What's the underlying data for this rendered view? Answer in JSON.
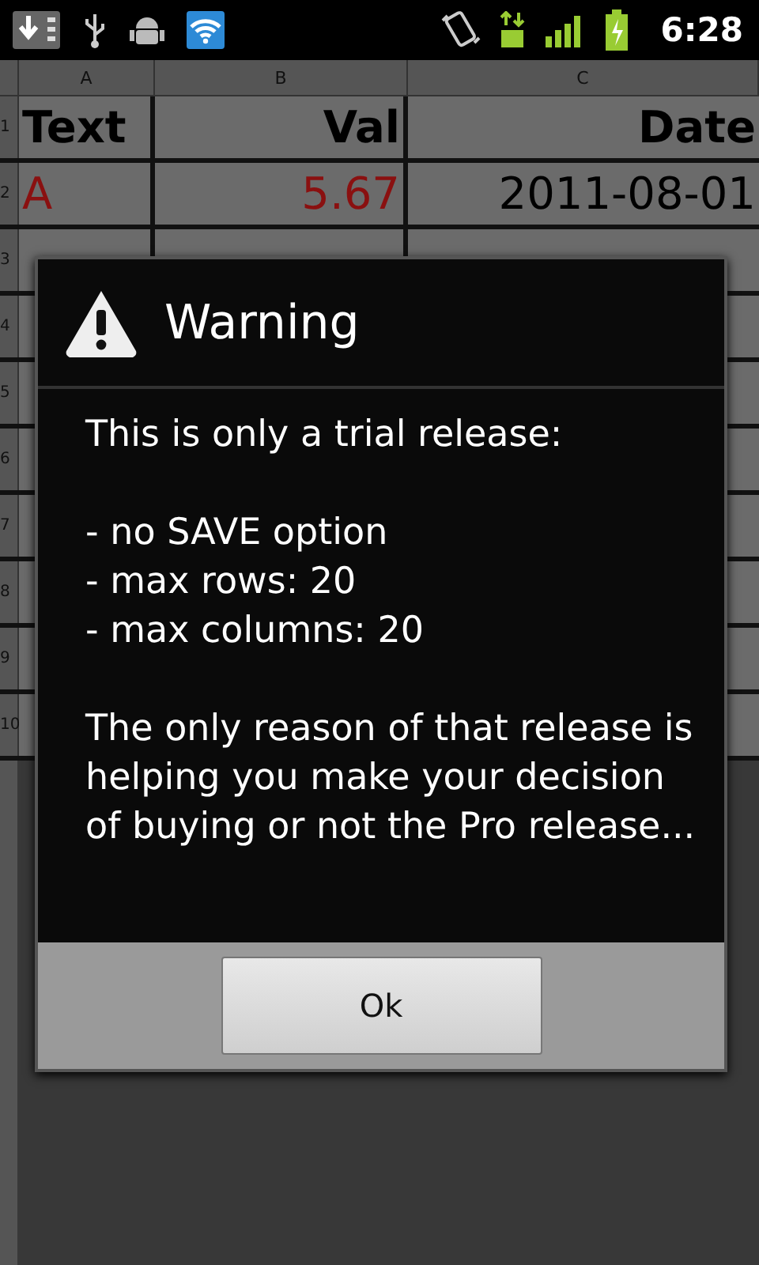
{
  "status_bar": {
    "time": "6:28"
  },
  "sheet": {
    "columns": [
      "A",
      "B",
      "C"
    ],
    "rows": [
      {
        "number": "1",
        "kind": "header",
        "cells": [
          "Text",
          "Val",
          "Date"
        ]
      },
      {
        "number": "2",
        "kind": "data",
        "cells": [
          "A",
          "5.67",
          "2011-08-01"
        ]
      },
      {
        "number": "3",
        "kind": "data",
        "cells": []
      },
      {
        "number": "4",
        "kind": "data",
        "cells": []
      },
      {
        "number": "5",
        "kind": "data",
        "cells": []
      },
      {
        "number": "6",
        "kind": "data",
        "cells": []
      },
      {
        "number": "7",
        "kind": "data",
        "cells": []
      },
      {
        "number": "8",
        "kind": "data",
        "cells": []
      },
      {
        "number": "9",
        "kind": "data",
        "cells": []
      },
      {
        "number": "10",
        "kind": "data",
        "cells": []
      }
    ]
  },
  "dialog": {
    "title": "Warning",
    "body": [
      {
        "kind": "text",
        "text": "This is only a trial release:"
      },
      {
        "kind": "list",
        "items": [
          "- no SAVE option",
          "- max rows: 20",
          "- max columns: 20"
        ]
      },
      {
        "kind": "text",
        "text": "The only reason of that release is helping you make your decision of buying or not the Pro release..."
      }
    ],
    "buttons": [
      "Ok"
    ]
  }
}
